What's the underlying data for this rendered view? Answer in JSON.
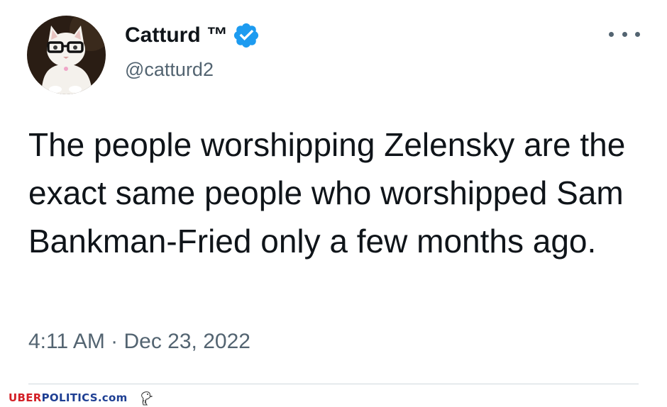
{
  "tweet": {
    "author": {
      "display_name": "Catturd ™",
      "handle": "@catturd2",
      "verified": true,
      "avatar_icon": "cat-with-glasses-avatar"
    },
    "text": "The people worshipping Zelensky are the exact same people who worshipped Sam Bankman-Fried only a few months ago.",
    "timestamp": "4:11 AM · Dec 23, 2022",
    "more_icon": "more-horizontal-icon"
  },
  "watermark": {
    "part1": "UBER",
    "part2": "POLITICS",
    "part3": ".com",
    "icon": "eagle-icon"
  },
  "colors": {
    "text": "#0f1419",
    "secondary": "#536471",
    "verified_blue": "#1d9bf0",
    "watermark_red": "#d31f26",
    "watermark_blue": "#1e3f93"
  }
}
